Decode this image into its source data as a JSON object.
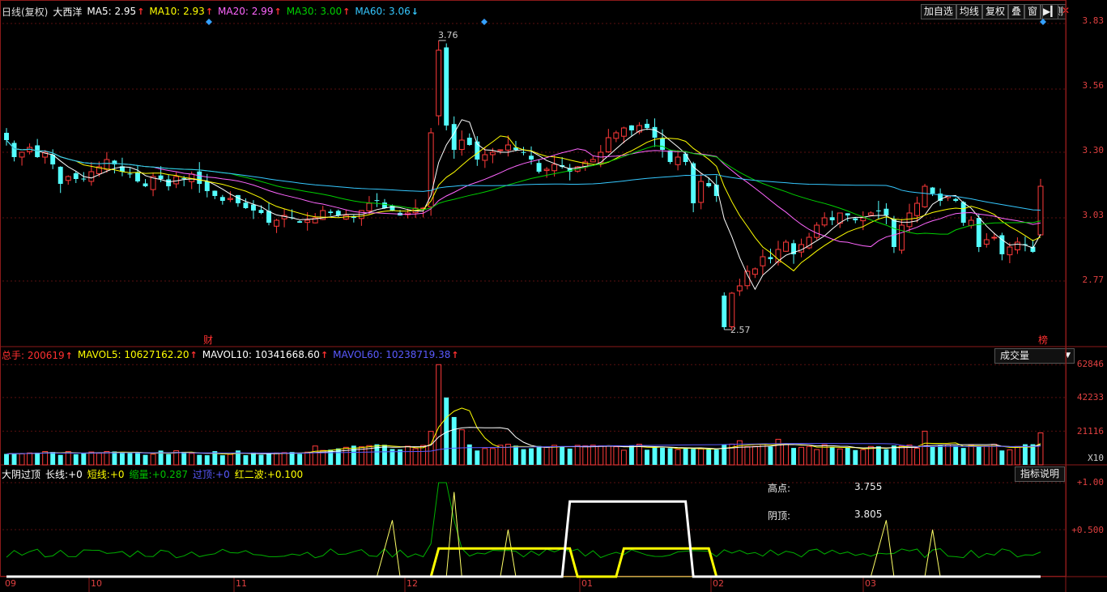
{
  "header": {
    "period": "日线(复权)",
    "stock": "大西洋",
    "ma": [
      {
        "label": "MA5:",
        "value": "2.95",
        "dir": "up",
        "color": "#ffffff"
      },
      {
        "label": "MA10:",
        "value": "2.93",
        "dir": "up",
        "color": "#ffff00"
      },
      {
        "label": "MA20:",
        "value": "2.99",
        "dir": "up",
        "color": "#ff66ff"
      },
      {
        "label": "MA30:",
        "value": "3.00",
        "dir": "up",
        "color": "#00d000"
      },
      {
        "label": "MA60:",
        "value": "3.06",
        "dir": "down",
        "color": "#35c8ff"
      }
    ]
  },
  "toolbar": {
    "buttons": [
      "加自选",
      "均线",
      "复权",
      "叠",
      "窗",
      "预测"
    ],
    "arrow": "▶▎",
    "close": "✕"
  },
  "price_axis": {
    "ticks": [
      "3.83",
      "3.56",
      "3.30",
      "3.03",
      "2.77"
    ]
  },
  "markers": {
    "high_label": "3.76",
    "low_label": "2.57",
    "event_left": "财",
    "event_right": "榜"
  },
  "volume": {
    "header": [
      {
        "label": "总手:",
        "value": "200619",
        "color": "#ff3030"
      },
      {
        "label": "MAVOL5:",
        "value": "10627162.20",
        "color": "#ffff00"
      },
      {
        "label": "MAVOL10:",
        "value": "10341668.60",
        "color": "#ffffff"
      },
      {
        "label": "MAVOL60:",
        "value": "10238719.38",
        "color": "#5a5aff"
      }
    ],
    "selector": "成交量",
    "ticks": [
      "62846",
      "42233",
      "21116"
    ],
    "unit": "X10"
  },
  "indicator": {
    "name": "大阴过顶",
    "header": [
      {
        "label": "长线:",
        "value": "+0",
        "color": "#ffffff"
      },
      {
        "label": "短线:",
        "value": "+0",
        "color": "#ffff00"
      },
      {
        "label": "缩量:",
        "value": "+0.287",
        "color": "#00c000"
      },
      {
        "label": "过顶:",
        "value": "+0",
        "color": "#5a5aff"
      },
      {
        "label": "红二波:",
        "value": "+0.100",
        "color": "#ffff00"
      }
    ],
    "help": "指标说明",
    "ticks": [
      "1.00",
      "0.500"
    ],
    "info": [
      {
        "label": "高点:",
        "value": "3.755"
      },
      {
        "label": "阴顶:",
        "value": "3.805"
      }
    ]
  },
  "time_axis": {
    "labels": [
      "09",
      "10",
      "11",
      "12",
      "01",
      "02",
      "03"
    ]
  },
  "chart_data": {
    "type": "candlestick",
    "title": "大西洋 日线(复权)",
    "y_ticks": [
      2.77,
      3.03,
      3.3,
      3.56,
      3.83
    ],
    "ylim": [
      2.5,
      3.86
    ],
    "high": 3.76,
    "low": 2.57,
    "x_months": [
      "09",
      "10",
      "11",
      "12",
      "01",
      "02",
      "03"
    ],
    "volume_ticks": [
      21116,
      42233,
      62846
    ],
    "indicator_ticks": [
      0.5,
      1.0
    ],
    "close_series": [
      3.35,
      3.28,
      3.3,
      3.32,
      3.28,
      3.3,
      3.25,
      3.17,
      3.2,
      3.19,
      3.19,
      3.22,
      3.24,
      3.27,
      3.25,
      3.22,
      3.21,
      3.18,
      3.16,
      3.2,
      3.19,
      3.16,
      3.2,
      3.19,
      3.21,
      3.17,
      3.14,
      3.12,
      3.1,
      3.11,
      3.09,
      3.07,
      3.06,
      3.05,
      3.01,
      3.02,
      3.04,
      3.03,
      3.01,
      3.02,
      3.03,
      3.06,
      3.05,
      3.04,
      3.04,
      3.03,
      3.06,
      3.09,
      3.1,
      3.07,
      3.06,
      3.04,
      3.05,
      3.07,
      3.07,
      3.38,
      3.72,
      3.41,
      3.31,
      3.35,
      3.33,
      3.27,
      3.29,
      3.3,
      3.31,
      3.33,
      3.31,
      3.3,
      3.27,
      3.22,
      3.23,
      3.25,
      3.24,
      3.22,
      3.24,
      3.26,
      3.27,
      3.3,
      3.36,
      3.38,
      3.4,
      3.39,
      3.41,
      3.4,
      3.36,
      3.31,
      3.26,
      3.28,
      3.26,
      3.09,
      3.18,
      3.16,
      3.12,
      2.58,
      2.72,
      2.75,
      2.81,
      2.82,
      2.87,
      2.86,
      2.9,
      2.93,
      2.88,
      2.92,
      2.95,
      3.0,
      3.03,
      3.02,
      3.05,
      3.04,
      3.02,
      3.03,
      3.05,
      3.06,
      3.04,
      2.91,
      3.0,
      3.05,
      3.09,
      3.16,
      3.13,
      3.1,
      3.12,
      3.1,
      3.01,
      3.02,
      2.91,
      2.94,
      2.95,
      2.88,
      2.91,
      2.93,
      2.92,
      2.89,
      3.16
    ]
  }
}
